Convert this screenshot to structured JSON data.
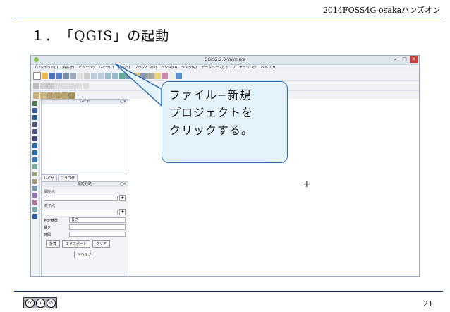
{
  "header": {
    "event": "2014FOSS4G-osakaハンズオン"
  },
  "slide": {
    "title": "１．　「QGIS」の起動"
  },
  "qgis": {
    "window_title": "QGIS2.2.0-Valmiera",
    "menu": [
      "プロジェクト(J)",
      "編集(E)",
      "ビュー(V)",
      "レイヤ(L)",
      "設定(S)",
      "プラグイン(P)",
      "ベクタ(O)",
      "ラスタ(R)",
      "データベース(D)",
      "プロセッシング",
      "ヘルプ(H)"
    ],
    "layers_panel": {
      "title": "レイヤ"
    },
    "tabs": [
      "レイヤ",
      "ブラウザ"
    ],
    "measure_panel": {
      "title": "最短経路",
      "start_label": "開始点",
      "end_label": "終了点",
      "criterion_label": "判定基準",
      "criterion_value": "長さ",
      "length_label": "長さ",
      "time_label": "時間",
      "calculate_button": "計算",
      "export_button": "エクスポート",
      "clear_button": "クリア",
      "help_button": "ヘルプ"
    }
  },
  "callout": {
    "line1": "ファイル−新規",
    "line2": "プロジェクトを",
    "line3": "クリックする。"
  },
  "footer": {
    "page_number": "21"
  }
}
